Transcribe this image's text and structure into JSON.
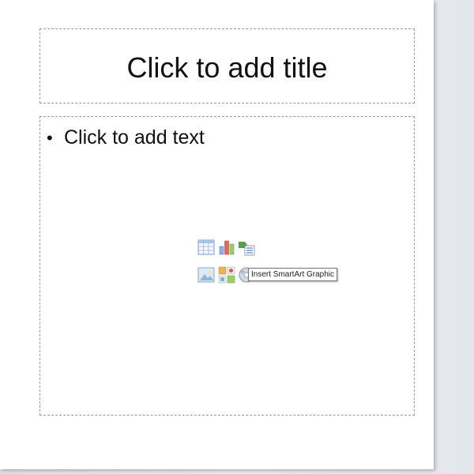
{
  "slide": {
    "title_placeholder": "Click to add title",
    "content_placeholder": {
      "bullet": "•",
      "text": "Click to add text"
    },
    "insert_icons": [
      {
        "name": "insert-table-icon",
        "tooltip": ""
      },
      {
        "name": "insert-chart-icon",
        "tooltip": ""
      },
      {
        "name": "insert-smartart-icon",
        "tooltip": "Insert SmartArt Graphic"
      },
      {
        "name": "insert-picture-icon",
        "tooltip": ""
      },
      {
        "name": "insert-clipart-icon",
        "tooltip": ""
      },
      {
        "name": "insert-media-icon",
        "tooltip": ""
      }
    ],
    "tooltip_text": "Insert SmartArt Graphic"
  },
  "colors": {
    "background": "#e6e9ed",
    "slide": "#ffffff",
    "placeholder_border": "#9a9a9a"
  }
}
